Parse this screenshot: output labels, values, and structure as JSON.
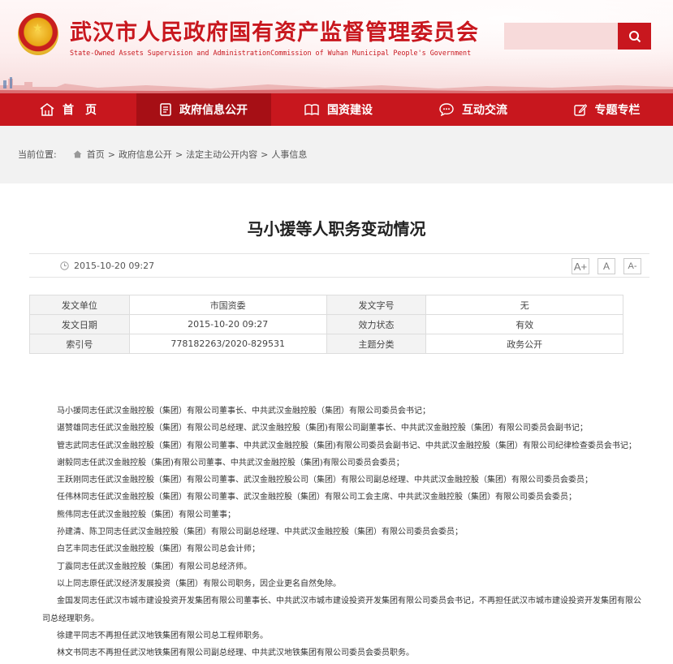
{
  "header": {
    "title": "武汉市人民政府国有资产监督管理委员会",
    "subtitle": "State-Owned Assets Supervision and AdministrationCommission of Wuhan Municipal People's Government",
    "search_placeholder": ""
  },
  "nav": {
    "items": [
      {
        "label": "首　页",
        "icon": "home-icon"
      },
      {
        "label": "政府信息公开",
        "icon": "document-icon",
        "active": true
      },
      {
        "label": "国资建设",
        "icon": "book-icon"
      },
      {
        "label": "互动交流",
        "icon": "chat-icon"
      },
      {
        "label": "专题专栏",
        "icon": "edit-icon"
      }
    ]
  },
  "breadcrumb": {
    "prefix": "当前位置:",
    "items": [
      "首页",
      "政府信息公开",
      "法定主动公开内容",
      "人事信息"
    ],
    "separator": ">"
  },
  "article": {
    "title": "马小援等人职务变动情况",
    "date": "2015-10-20 09:27",
    "font_buttons": [
      "A+",
      "A",
      "A-"
    ],
    "info_table": [
      [
        "发文单位",
        "市国资委",
        "发文字号",
        "无"
      ],
      [
        "发文日期",
        "2015-10-20 09:27",
        "效力状态",
        "有效"
      ],
      [
        "索引号",
        "778182263/2020-829531",
        "主题分类",
        "政务公开"
      ]
    ],
    "paragraphs": [
      "马小援同志任武汉金融控股（集团）有限公司董事长、中共武汉金融控股（集团）有限公司委员会书记；",
      "谌赞雄同志任武汉金融控股（集团）有限公司总经理、武汉金融控股（集团)有限公司副董事长、中共武汉金融控股（集团）有限公司委员会副书记；",
      "管志武同志任武汉金融控股（集团）有限公司董事、中共武汉金融控股（集团)有限公司委员会副书记、中共武汉金融控股（集团）有限公司纪律检查委员会书记；",
      "谢毅同志任武汉金融控股（集团)有限公司董事、中共武汉金融控股（集团)有限公司委员会委员；",
      "王跃刚同志任武汉金融控股（集团）有限公司董事、武汉金融控股公司（集团）有限公司副总经理、中共武汉金融控股（集团）有限公司委员会委员；",
      "任伟林同志任武汉金融控股（集团）有限公司董事、武汉金融控股（集团）有限公司工会主席、中共武汉金融控股（集团）有限公司委员会委员；",
      "熊伟同志任武汉金融控股（集团）有限公司董事；",
      "孙建清、陈卫同志任武汉金融控股（集团）有限公司副总经理、中共武汉金融控股（集团）有限公司委员会委员；",
      "白艺丰同志任武汉金融控股（集团）有限公司总会计师；",
      "丁震同志任武汉金融控股（集团）有限公司总经济师。",
      "以上同志原任武汉经济发展投资（集团）有限公司职务，因企业更名自然免除。",
      "金国发同志任武汉市城市建设投资开发集团有限公司董事长、中共武汉市城市建设投资开发集团有限公司委员会书记，不再担任武汉市城市建设投资开发集团有限公司总经理职务。",
      "徐建平同志不再担任武汉地铁集团有限公司总工程师职务。",
      "林文书同志不再担任武汉地铁集团有限公司副总经理、中共武汉地铁集团有限公司委员会委员职务。"
    ]
  },
  "colors": {
    "brand_red": "#c8171e",
    "nav_active": "#a60f15"
  }
}
